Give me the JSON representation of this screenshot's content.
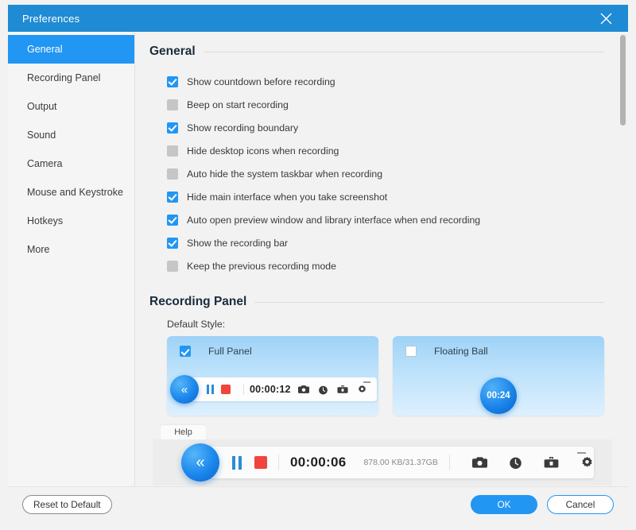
{
  "window": {
    "title": "Preferences",
    "close_icon": "close-icon"
  },
  "sidebar": {
    "items": [
      {
        "label": "General",
        "active": true
      },
      {
        "label": "Recording Panel",
        "active": false
      },
      {
        "label": "Output",
        "active": false
      },
      {
        "label": "Sound",
        "active": false
      },
      {
        "label": "Camera",
        "active": false
      },
      {
        "label": "Mouse and Keystroke",
        "active": false
      },
      {
        "label": "Hotkeys",
        "active": false
      },
      {
        "label": "More",
        "active": false
      }
    ]
  },
  "general": {
    "heading": "General",
    "options": [
      {
        "label": "Show countdown before recording",
        "checked": true
      },
      {
        "label": "Beep on start recording",
        "checked": false
      },
      {
        "label": "Show recording boundary",
        "checked": true
      },
      {
        "label": "Hide desktop icons when recording",
        "checked": false
      },
      {
        "label": "Auto hide the system taskbar when recording",
        "checked": false
      },
      {
        "label": "Hide main interface when you take screenshot",
        "checked": true
      },
      {
        "label": "Auto open preview window and library interface when end recording",
        "checked": true
      },
      {
        "label": "Show the recording bar",
        "checked": true
      },
      {
        "label": "Keep the previous recording mode",
        "checked": false
      }
    ]
  },
  "recording_panel": {
    "heading": "Recording Panel",
    "default_style_label": "Default Style:",
    "cards": [
      {
        "label": "Full Panel",
        "checked": true,
        "timer": "00:00:12",
        "icons": [
          "camera-icon",
          "clock-icon",
          "toolbox-icon",
          "gear-icon"
        ],
        "minimize_icon": "minimize-icon"
      },
      {
        "label": "Floating Ball",
        "checked": false,
        "timer": "00:24"
      }
    ]
  },
  "preview_bar": {
    "help_label": "Help",
    "collapse_icon": "double-chevron-left-icon",
    "pause_icon": "pause-icon",
    "stop_icon": "stop-icon",
    "timer": "00:00:06",
    "storage": "878.00 KB/31.37GB",
    "icons": [
      "camera-icon",
      "clock-icon",
      "toolbox-icon",
      "gear-icon"
    ],
    "minimize_icon": "minimize-icon"
  },
  "footer": {
    "reset_label": "Reset to Default",
    "ok_label": "OK",
    "cancel_label": "Cancel"
  },
  "colors": {
    "titlebar": "#1e8bd4",
    "accent": "#2196f3",
    "record_red": "#f0443c",
    "card_blue": "#9ed2f7"
  }
}
